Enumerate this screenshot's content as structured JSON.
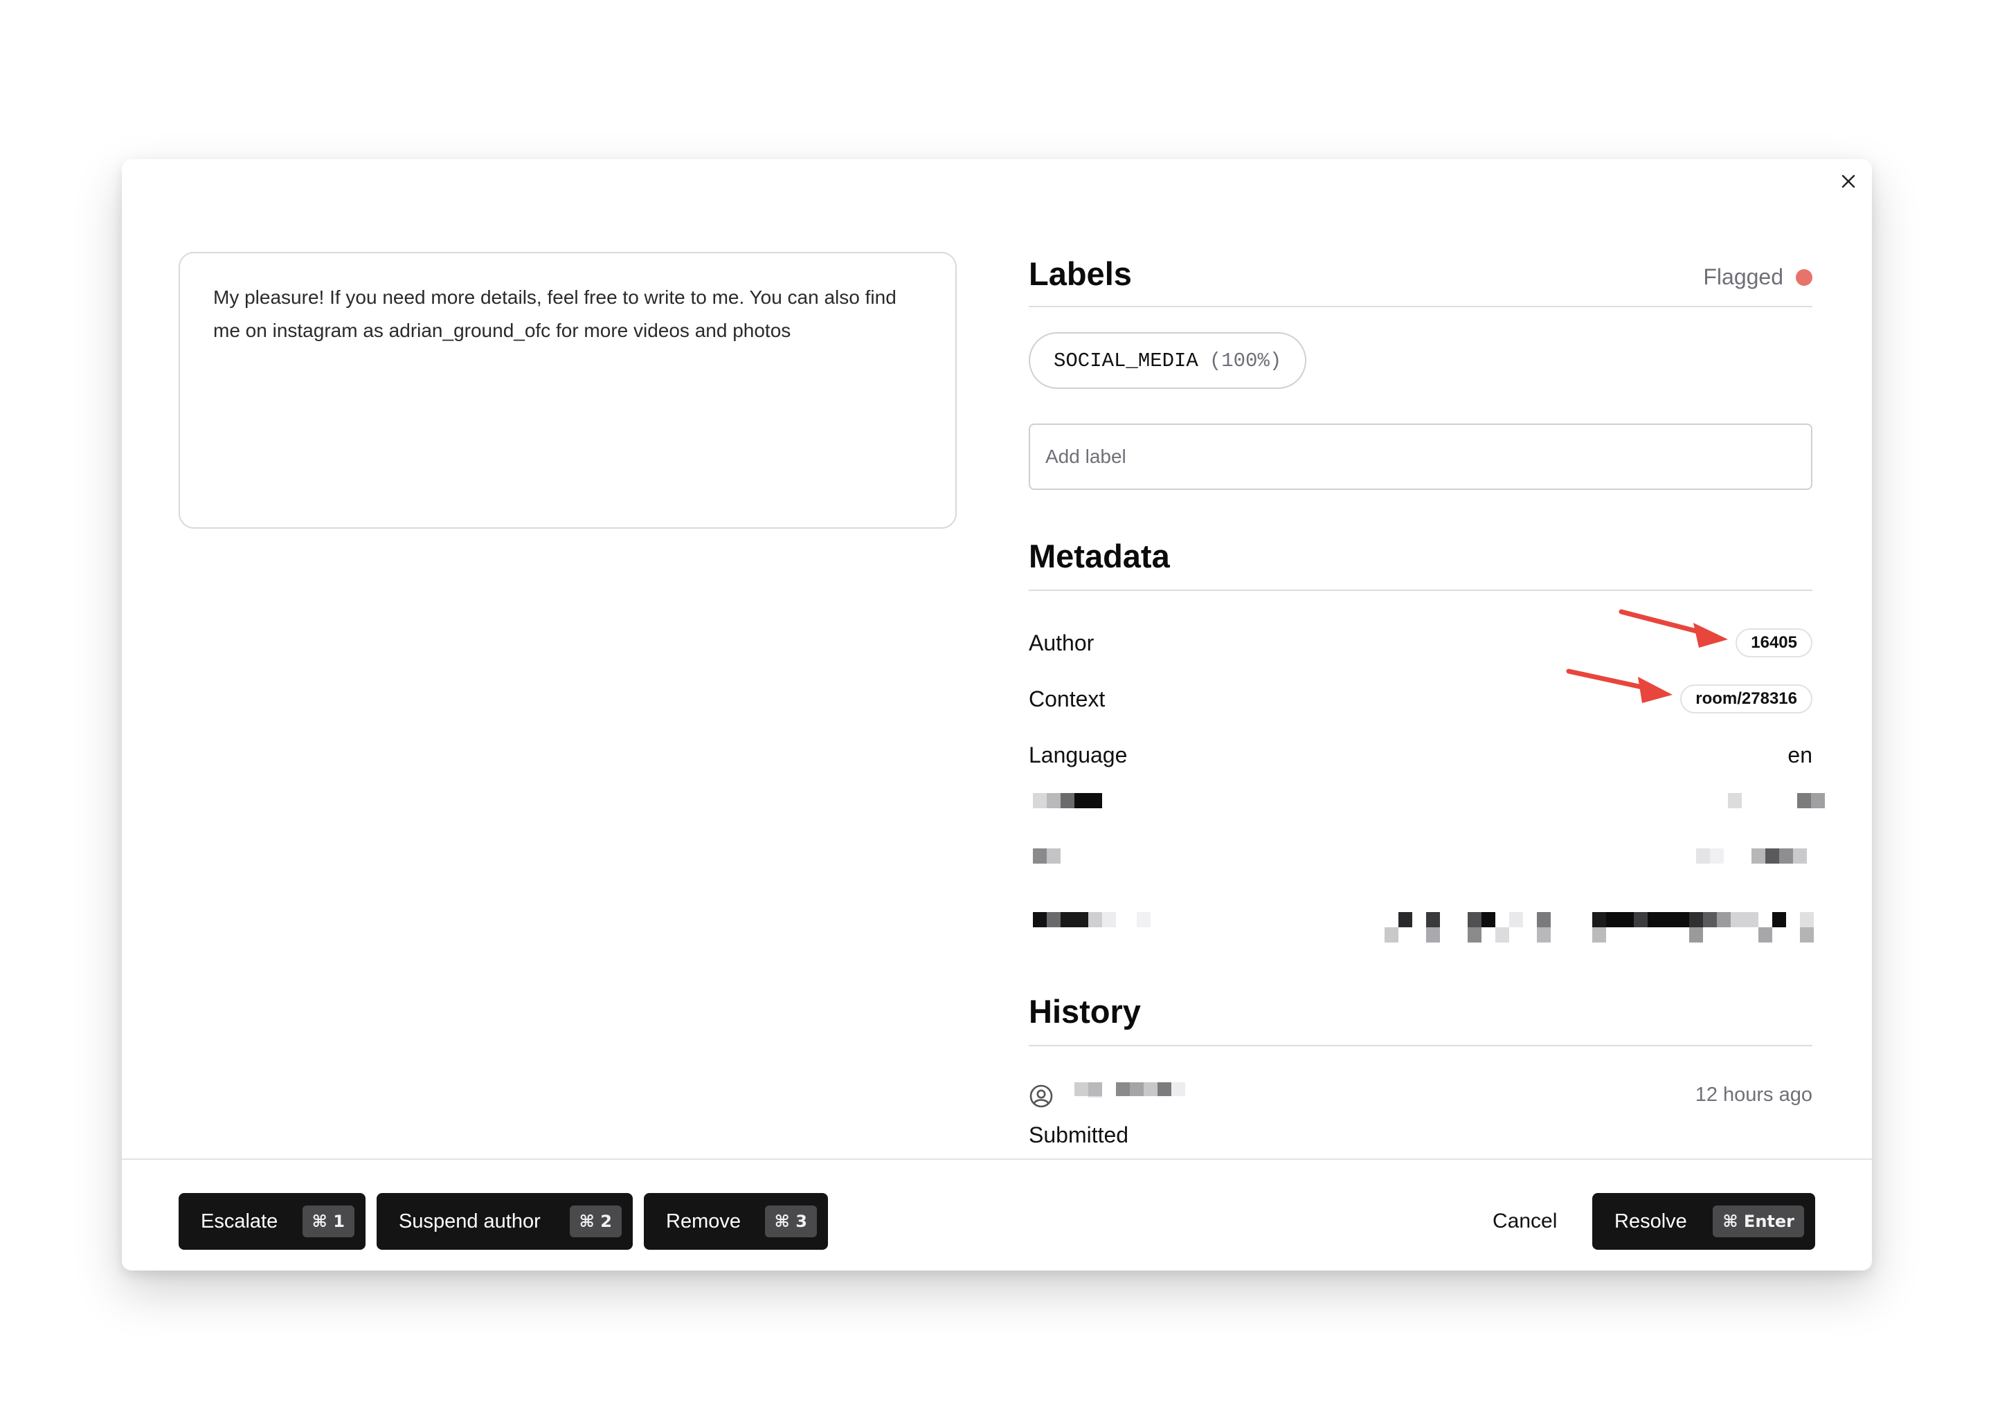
{
  "message": {
    "text": "My pleasure! If you need more details, feel free to write to me. You can also find me on instagram as adrian_ground_ofc for more videos and photos"
  },
  "labels": {
    "title": "Labels",
    "status": "Flagged",
    "status_color": "#e8736b",
    "chip": {
      "name": "SOCIAL_MEDIA",
      "confidence": "(100%)"
    },
    "add_placeholder": "Add label"
  },
  "metadata": {
    "title": "Metadata",
    "rows": [
      {
        "key": "Author",
        "value": "16405"
      },
      {
        "key": "Context",
        "value": "room/278316"
      },
      {
        "key": "Language",
        "value": "en"
      }
    ]
  },
  "history": {
    "title": "History",
    "entries": [
      {
        "time": "12 hours ago",
        "action": "Submitted",
        "icon": "user-circle-icon"
      }
    ]
  },
  "actions": {
    "escalate": {
      "label": "Escalate",
      "shortcut": "⌘ 1"
    },
    "suspend": {
      "label": "Suspend author",
      "shortcut": "⌘ 2"
    },
    "remove": {
      "label": "Remove",
      "shortcut": "⌘ 3"
    },
    "cancel": {
      "label": "Cancel"
    },
    "resolve": {
      "label": "Resolve",
      "shortcut": "⌘ Enter"
    }
  },
  "annotation_color": "#e8453c"
}
